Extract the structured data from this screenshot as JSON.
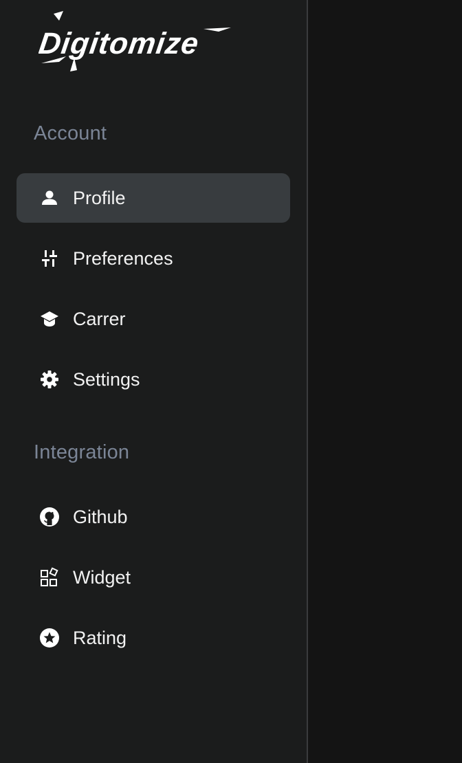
{
  "brand": {
    "name": "Digitomize"
  },
  "sidebar": {
    "sections": [
      {
        "title": "Account",
        "items": [
          {
            "label": "Profile",
            "icon": "person-icon",
            "active": true
          },
          {
            "label": "Preferences",
            "icon": "sliders-icon",
            "active": false
          },
          {
            "label": "Carrer",
            "icon": "graduation-cap-icon",
            "active": false
          },
          {
            "label": "Settings",
            "icon": "gear-icon",
            "active": false
          }
        ]
      },
      {
        "title": "Integration",
        "items": [
          {
            "label": "Github",
            "icon": "github-icon",
            "active": false
          },
          {
            "label": "Widget",
            "icon": "widget-icon",
            "active": false
          },
          {
            "label": "Rating",
            "icon": "star-circle-icon",
            "active": false
          }
        ]
      }
    ]
  },
  "colors": {
    "sidebar_bg": "#1b1c1c",
    "main_bg": "#141414",
    "active_item_bg": "#383c3f",
    "section_title": "#7b8596",
    "item_text": "#f2f2f2",
    "divider": "#3a3b3d"
  }
}
